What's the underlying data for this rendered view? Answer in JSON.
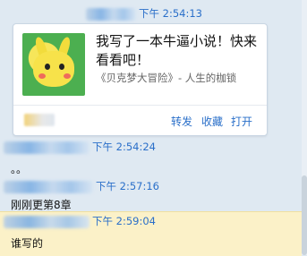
{
  "messages": [
    {
      "time": "下午 2:54:13",
      "card": {
        "title": "我写了一本牛逼小说！快来看看吧！",
        "subtitle": "《贝克梦大冒险》- 人生的枷锁",
        "actions": [
          "转发",
          "收藏",
          "打开"
        ]
      }
    },
    {
      "time": "下午 2:54:24",
      "text": "。。"
    },
    {
      "time": "下午 2:57:16",
      "text": "刚刚更第8章"
    },
    {
      "time": "下午 2:59:04",
      "text": "谁写的"
    }
  ],
  "colors": {
    "background": "#dfe9f2",
    "timestamp": "#2a6fc9",
    "highlight": "#fbf1c8"
  },
  "icons": {
    "thumbnail": "pikachu-thumbnail-icon",
    "source": "source-app-icon"
  }
}
